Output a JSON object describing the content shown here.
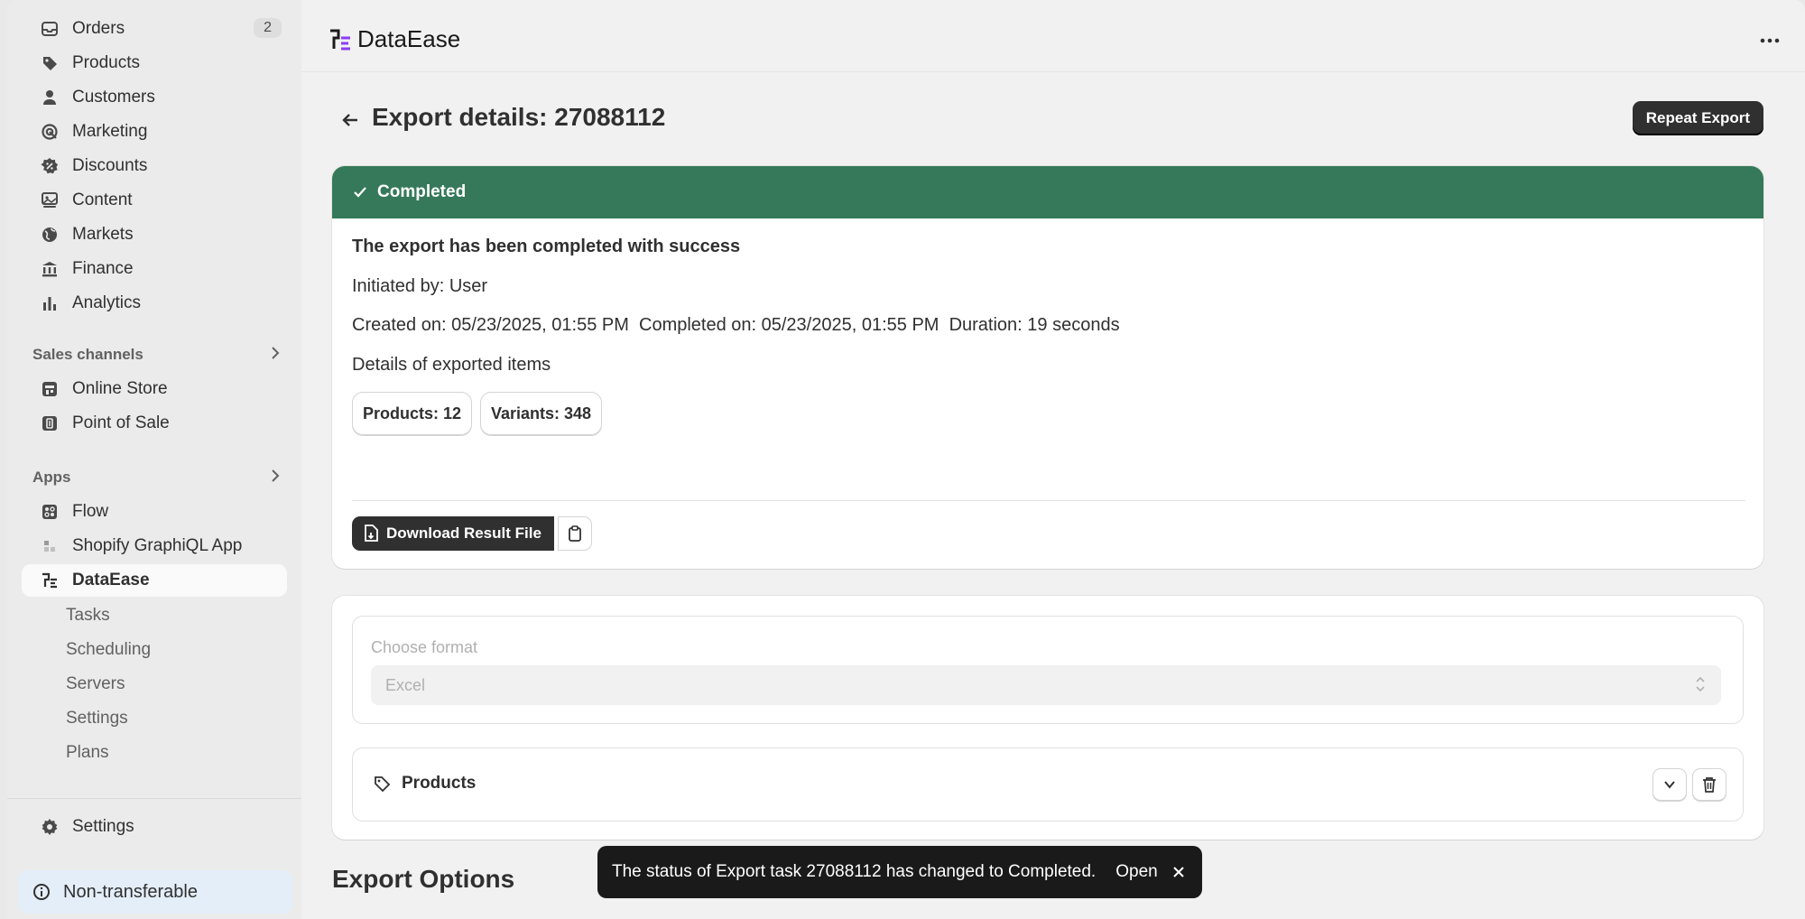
{
  "sidebar": {
    "items": [
      {
        "label": "Orders",
        "icon": "orders-icon",
        "badge": "2"
      },
      {
        "label": "Products",
        "icon": "tag-icon"
      },
      {
        "label": "Customers",
        "icon": "person-icon"
      },
      {
        "label": "Marketing",
        "icon": "target-icon"
      },
      {
        "label": "Discounts",
        "icon": "discount-icon"
      },
      {
        "label": "Content",
        "icon": "content-icon"
      },
      {
        "label": "Markets",
        "icon": "globe-icon"
      },
      {
        "label": "Finance",
        "icon": "bank-icon"
      },
      {
        "label": "Analytics",
        "icon": "bar-chart-icon"
      }
    ],
    "sales_channels_title": "Sales channels",
    "sales_channels": [
      {
        "label": "Online Store",
        "icon": "store-icon"
      },
      {
        "label": "Point of Sale",
        "icon": "pos-icon"
      }
    ],
    "apps_title": "Apps",
    "apps": [
      {
        "label": "Flow",
        "icon": "flow-icon"
      },
      {
        "label": "Shopify GraphiQL App",
        "icon": "graphiql-icon"
      },
      {
        "label": "DataEase",
        "icon": "dataease-icon"
      }
    ],
    "dataease_sub": [
      "Tasks",
      "Scheduling",
      "Servers",
      "Settings",
      "Plans"
    ],
    "settings_label": "Settings",
    "non_transferable": "Non-transferable"
  },
  "topbar": {
    "brand": "DataEase",
    "brand_colors": {
      "dark": "#1a1a1a",
      "accent": "#8b3cf7"
    }
  },
  "page": {
    "title": "Export details: 27088112",
    "repeat_label": "Repeat Export"
  },
  "status": {
    "header": "Completed",
    "header_color": "#36795a",
    "success_text": "The export has been completed with success",
    "initiated": "Initiated by: User",
    "timing": "Created on: 05/23/2025, 01:55 PM  Completed on: 05/23/2025, 01:55 PM  Duration: 19 seconds",
    "details_title": "Details of exported items",
    "pills": [
      "Products: 12",
      "Variants: 348"
    ],
    "download_label": "Download Result File"
  },
  "config": {
    "format_label": "Choose format",
    "format_value": "Excel",
    "entity_label": "Products"
  },
  "export_options_title": "Export Options",
  "toast": {
    "message": "The status of Export task 27088112 has changed to Completed.",
    "action": "Open"
  }
}
